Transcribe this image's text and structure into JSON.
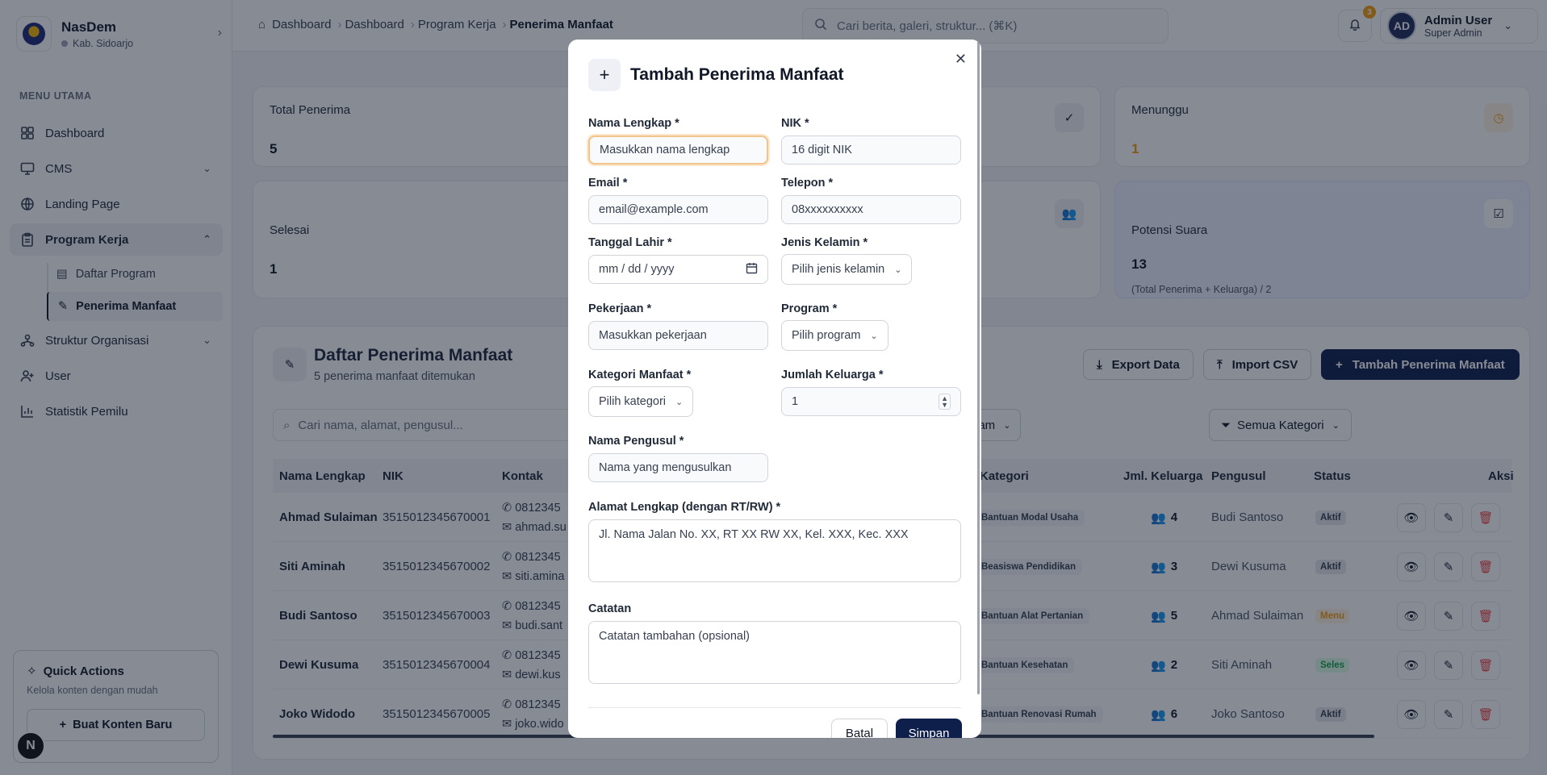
{
  "brand": {
    "name": "NasDem",
    "region": "Kab. Sidoarjo"
  },
  "sidebar": {
    "menu_label": "MENU UTAMA",
    "items": [
      {
        "label": "Dashboard",
        "icon": "grid-icon"
      },
      {
        "label": "CMS",
        "icon": "monitor-icon"
      },
      {
        "label": "Landing Page",
        "icon": "globe-icon"
      },
      {
        "label": "Program Kerja",
        "icon": "clipboard-icon"
      },
      {
        "label": "Struktur Organisasi",
        "icon": "network-icon"
      },
      {
        "label": "User",
        "icon": "user-plus-icon"
      },
      {
        "label": "Statistik Pemilu",
        "icon": "bar-chart-icon"
      }
    ],
    "sub_items": [
      {
        "label": "Daftar Program"
      },
      {
        "label": "Penerima Manfaat"
      }
    ],
    "quick_actions": {
      "title": "Quick Actions",
      "subtitle": "Kelola konten dengan mudah",
      "button": "Buat Konten Baru"
    },
    "avatar_letter": "N"
  },
  "topbar": {
    "breadcrumbs": [
      "Dashboard",
      "Dashboard",
      "Program Kerja",
      "Penerima Manfaat"
    ],
    "search_placeholder": "Cari berita, galeri, struktur... (⌘K)",
    "notif_count": "3",
    "user": {
      "initials": "AD",
      "name": "Admin User",
      "role": "Super Admin"
    }
  },
  "stats": [
    {
      "label": "Total Penerima",
      "value": "5"
    },
    {
      "label": "Menunggu",
      "value": "1"
    },
    {
      "label": "Selesai",
      "value": "1"
    },
    {
      "label": "Potensi Suara",
      "value": "13",
      "note": "(Total Penerima + Keluarga) / 2"
    }
  ],
  "list": {
    "title": "Daftar Penerima Manfaat",
    "subtitle": "5 penerima manfaat ditemukan",
    "export": "Export Data",
    "import": "Import CSV",
    "add": "Tambah Penerima Manfaat",
    "search_placeholder": "Cari nama, alamat, pengusul...",
    "filter_program": "gram",
    "filter_category": "Semua Kategori",
    "columns": [
      "Nama Lengkap",
      "NIK",
      "Kontak",
      "Kategori",
      "Jml. Keluarga",
      "Pengusul",
      "Status",
      "Aksi"
    ],
    "rows": [
      {
        "name": "Ahmad Sulaiman",
        "nik": "3515012345670001",
        "phone": "0812345",
        "email": "ahmad.su",
        "category": "Bantuan Modal Usaha",
        "family": "4",
        "proposer": "Budi Santoso",
        "status": "Aktif"
      },
      {
        "name": "Siti Aminah",
        "nik": "3515012345670002",
        "phone": "0812345",
        "email": "siti.amina",
        "category": "Beasiswa Pendidikan",
        "family": "3",
        "proposer": "Dewi Kusuma",
        "status": "Aktif"
      },
      {
        "name": "Budi Santoso",
        "nik": "3515012345670003",
        "phone": "0812345",
        "email": "budi.sant",
        "category": "Bantuan Alat Pertanian",
        "family": "5",
        "proposer": "Ahmad Sulaiman",
        "status": "Menu"
      },
      {
        "name": "Dewi Kusuma",
        "nik": "3515012345670004",
        "phone": "0812345",
        "email": "dewi.kus",
        "category": "Bantuan Kesehatan",
        "family": "2",
        "proposer": "Siti Aminah",
        "status": "Seles"
      },
      {
        "name": "Joko Widodo",
        "nik": "3515012345670005",
        "phone": "0812345",
        "email": "joko.wido",
        "category": "Bantuan Renovasi Rumah",
        "family": "6",
        "proposer": "Joko Santoso",
        "status": "Aktif"
      }
    ]
  },
  "modal": {
    "title": "Tambah Penerima Manfaat",
    "fields": {
      "nama": {
        "label": "Nama Lengkap *",
        "placeholder": "Masukkan nama lengkap"
      },
      "nik": {
        "label": "NIK *",
        "placeholder": "16 digit NIK"
      },
      "email": {
        "label": "Email *",
        "placeholder": "email@example.com"
      },
      "telepon": {
        "label": "Telepon *",
        "placeholder": "08xxxxxxxxxx"
      },
      "tanggal": {
        "label": "Tanggal Lahir *",
        "placeholder": "mm / dd / yyyy"
      },
      "kelamin": {
        "label": "Jenis Kelamin *",
        "value": "Pilih jenis kelamin"
      },
      "pekerjaan": {
        "label": "Pekerjaan *",
        "placeholder": "Masukkan pekerjaan"
      },
      "program": {
        "label": "Program *",
        "value": "Pilih program"
      },
      "kategori": {
        "label": "Kategori Manfaat *",
        "value": "Pilih kategori"
      },
      "keluarga": {
        "label": "Jumlah Keluarga *",
        "value": "1"
      },
      "pengusul": {
        "label": "Nama Pengusul *",
        "placeholder": "Nama yang mengusulkan"
      },
      "alamat": {
        "label": "Alamat Lengkap (dengan RT/RW) *",
        "placeholder": "Jl. Nama Jalan No. XX, RT XX RW XX, Kel. XXX, Kec. XXX"
      },
      "catatan": {
        "label": "Catatan",
        "placeholder": "Catatan tambahan (opsional)"
      }
    },
    "cancel": "Batal",
    "save": "Simpan"
  },
  "colors": {
    "primary": "#0f1f4b",
    "warning": "#f59e0b",
    "overlay": "rgba(15,23,42,0.5)",
    "potensi_bg": "#eef0ff"
  }
}
